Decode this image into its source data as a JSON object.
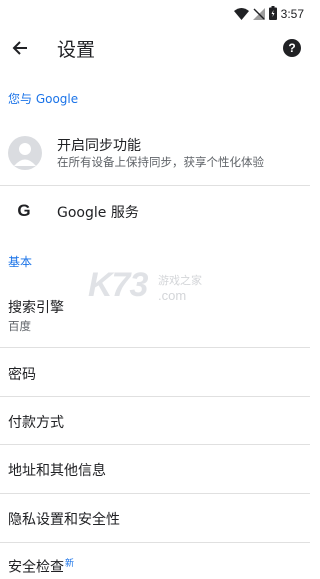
{
  "status_bar": {
    "time": "3:57",
    "icons": [
      "wifi-icon",
      "no-signal-icon",
      "battery-icon"
    ]
  },
  "app_bar": {
    "title": "设置",
    "back_icon": "arrow-left-icon",
    "help_icon": "help-icon",
    "help_glyph": "?"
  },
  "sections": {
    "you_and_google": "您与 Google",
    "basics": "基本"
  },
  "sync": {
    "title": "开启同步功能",
    "subtitle": "在所有设备上保持同步，获享个性化体验"
  },
  "google_services": {
    "icon_glyph": "G",
    "label": "Google 服务"
  },
  "items": {
    "search_engine": {
      "title": "搜索引擎",
      "value": "百度"
    },
    "passwords": {
      "title": "密码"
    },
    "payment_methods": {
      "title": "付款方式"
    },
    "addresses": {
      "title": "地址和其他信息"
    },
    "privacy": {
      "title": "隐私设置和安全性"
    },
    "safety_check": {
      "title": "安全检查",
      "badge": "新"
    }
  },
  "watermark": {
    "logo": "K73",
    "cn": "游戏之家",
    "com": ".com"
  },
  "colors": {
    "accent": "#1a73e8",
    "text": "#202124",
    "secondary": "#5f6368",
    "divider": "#e0e0e0"
  }
}
